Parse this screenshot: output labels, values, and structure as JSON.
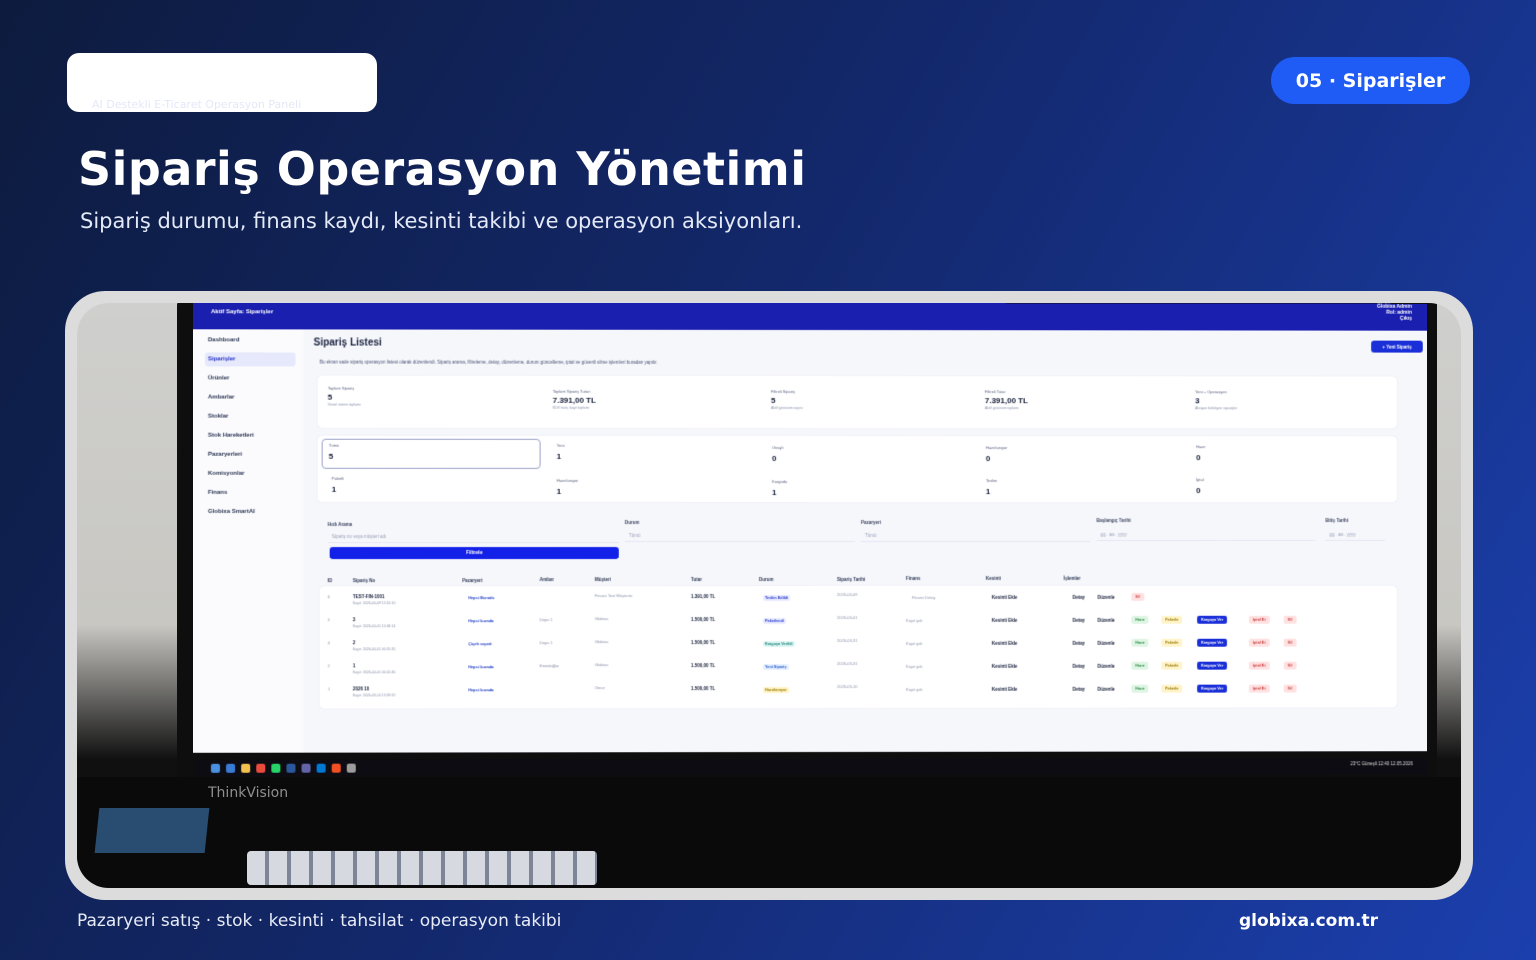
{
  "slide": {
    "logo_sub": "AI Destekli E-Ticaret Operasyon Paneli",
    "badge": "05 · Siparişler",
    "title": "Sipariş Operasyon Yönetimi",
    "subtitle": "Sipariş durumu, finans kaydı, kesinti takibi ve operasyon aksiyonları.",
    "footer_left": "Pazaryeri satış · stok · kesinti · tahsilat · operasyon takibi",
    "footer_right": "globixa.com.tr",
    "brand_color": "#1f5bf5"
  },
  "app": {
    "active_page": "Aktif Sayfa: Siparişler",
    "user_name": "Globixa Admin",
    "user_role": "Rol: admin",
    "logout": "Çıkış",
    "sidebar": [
      "Dashboard",
      "Siparişler",
      "Ürünler",
      "Ambarlar",
      "Stoklar",
      "Stok Hareketleri",
      "Pazaryerleri",
      "Komisyonlar",
      "Finans",
      "Globixa SmartAI"
    ],
    "list_title": "Sipariş Listesi",
    "list_desc": "Bu ekran sade sipariş operasyon listesi olarak düzenlendi. Sipariş arama, filtreleme, detay, düzenleme, durum güncelleme, iptal ve güvenli silme işlemleri buradan yapılır.",
    "new_order": "+ Yeni Sipariş",
    "stats": [
      {
        "label": "Toplam Sipariş",
        "value": "5",
        "sub": "Genel sistem toplamı"
      },
      {
        "label": "Toplam Sipariş Tutarı",
        "value": "7.391,00 TL",
        "sub": "KDV hariç kayıt toplamı"
      },
      {
        "label": "Filtreli Sipariş",
        "value": "5",
        "sub": "Aktif görünüm sayısı"
      },
      {
        "label": "Filtreli Tutar",
        "value": "7.391,00 TL",
        "sub": "Aktif görünüm toplamı"
      },
      {
        "label": "Yeni + Operasyon",
        "value": "3",
        "sub": "Aksiyon bekleyen siparişler"
      }
    ],
    "counts": [
      {
        "label": "Tümü",
        "value": "5"
      },
      {
        "label": "Yeni",
        "value": "1"
      },
      {
        "label": "Onaylı",
        "value": "0"
      },
      {
        "label": "Hazırlanıyor",
        "value": "0"
      },
      {
        "label": "Hazır",
        "value": "0"
      },
      {
        "label": "Paketli",
        "value": "1"
      },
      {
        "label": "Hazırlanıyor",
        "value": "1"
      },
      {
        "label": "Kargoda",
        "value": "1"
      },
      {
        "label": "Teslim",
        "value": "1"
      },
      {
        "label": "İptal",
        "value": "0"
      }
    ],
    "filters": {
      "search_label": "Hızlı Arama",
      "search_placeholder": "Sipariş no veya müşteri adı",
      "status_label": "Durum",
      "status_value": "Tümü",
      "market_label": "Pazaryeri",
      "market_value": "Tümü",
      "start_label": "Başlangıç Tarihi",
      "start_value": "gg . aa . yyyy",
      "end_label": "Bitiş Tarihi",
      "end_value": "gg . aa . yyyy",
      "filter_button": "Filtrele"
    },
    "columns": [
      "ID",
      "Sipariş No",
      "Pazaryeri",
      "Ambar",
      "Müşteri",
      "Tutar",
      "Durum",
      "Sipariş Tarihi",
      "Finans",
      "Kesinti",
      "İşlemler"
    ],
    "rows": [
      {
        "id": "6",
        "no": "TEST-FIN-1001",
        "kayit": "Kayıt: 2026-04-09 15:16:10",
        "market": "Hepsi Burada",
        "ambar": "",
        "musteri": "Finans Test Müşterisi",
        "tutar": "1.391,00 TL",
        "durum": "Teslim Edildi",
        "tarih": "2026-04-09",
        "finans": "Finans Detay",
        "kesinti": "Kesinti Ekle",
        "actions": [
          "Detay",
          "Düzenle",
          "Sil"
        ]
      },
      {
        "id": "5",
        "no": "3",
        "kayit": "Kayıt: 2026-04-01 10:34:14",
        "market": "Hepsi burada",
        "ambar": "Depo 1",
        "musteri": "Globixa",
        "tutar": "1.500,00 TL",
        "durum": "Paketlendi",
        "tarih": "2026-04-01",
        "finans": "Kayıt yok",
        "kesinti": "Kesinti Ekle",
        "actions": [
          "Detay",
          "Düzenle",
          "Hazır",
          "Paketle",
          "Kargoya Ver",
          "İptal Et",
          "Sil"
        ]
      },
      {
        "id": "4",
        "no": "2",
        "kayit": "Kayıt: 2026-04-01 00:55:35",
        "market": "Çiçek sepeti",
        "ambar": "Depo 1",
        "musteri": "Globixa",
        "tutar": "1.500,00 TL",
        "durum": "Kargoya Verildi",
        "tarih": "2026-03-31",
        "finans": "Kayıt yok",
        "kesinti": "Kesinti Ekle",
        "actions": [
          "Detay",
          "Düzenle",
          "Hazır",
          "Paketle",
          "Kargoya Ver",
          "İptal Et",
          "Sil"
        ]
      },
      {
        "id": "2",
        "no": "1",
        "kayit": "Kayıt: 2026-04-01 00:42:46",
        "market": "Hepsi burada",
        "ambar": "Emirdağlar",
        "musteri": "Globixa",
        "tutar": "1.500,00 TL",
        "durum": "Yeni Sipariş",
        "tarih": "2026-03-31",
        "finans": "Kayıt yok",
        "kesinti": "Kesinti Ekle",
        "actions": [
          "Detay",
          "Düzenle",
          "Hazır",
          "Paketle",
          "Kargoya Ver",
          "İptal Et",
          "Sil"
        ]
      },
      {
        "id": "1",
        "no": "2026 10",
        "kayit": "Kayıt: 2026-03-10 13:39:32",
        "market": "Hepsi burada",
        "ambar": "",
        "musteri": "Ömer",
        "tutar": "1.500,00 TL",
        "durum": "Hazırlanıyor",
        "tarih": "2026-03-10",
        "finans": "Kayıt yok",
        "kesinti": "Kesinti Ekle",
        "actions": [
          "Detay",
          "Düzenle",
          "Hazır",
          "Paketle",
          "Kargoya Ver",
          "İptal Et",
          "Sil"
        ]
      }
    ],
    "tray": "23°C Güneşli   12:40   12.05.2026",
    "monitor_brand": "ThinkVision"
  }
}
